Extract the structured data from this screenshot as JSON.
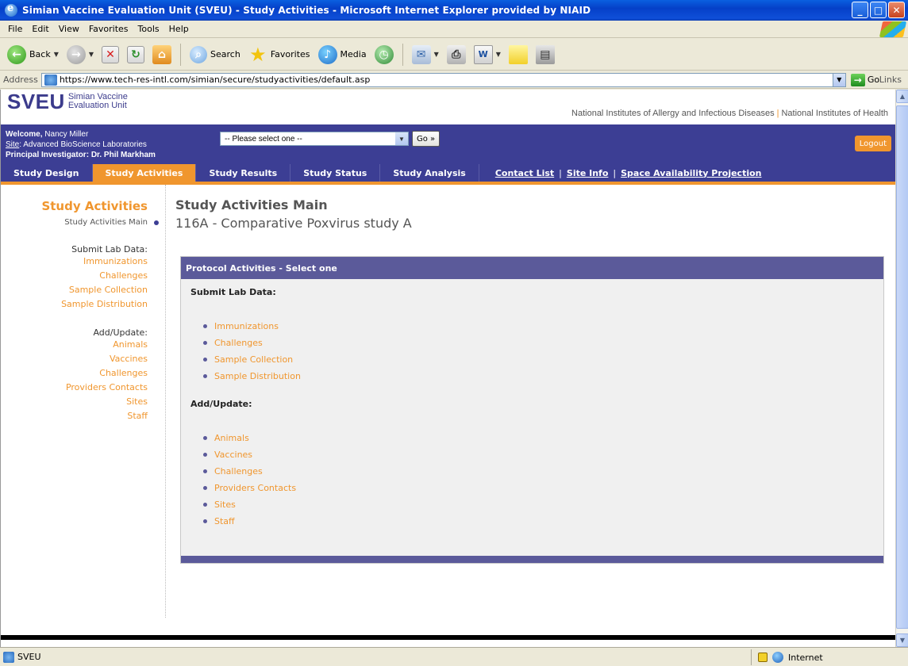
{
  "window": {
    "title": "Simian Vaccine Evaluation Unit (SVEU) - Study Activities - Microsoft Internet Explorer provided by NIAID"
  },
  "menu": [
    "File",
    "Edit",
    "View",
    "Favorites",
    "Tools",
    "Help"
  ],
  "toolbar": {
    "back": "Back",
    "search": "Search",
    "favorites": "Favorites",
    "media": "Media"
  },
  "address": {
    "label": "Address",
    "url": "https://www.tech-res-intl.com/simian/secure/studyactivities/default.asp",
    "go": "Go",
    "links": "Links"
  },
  "header": {
    "logo_big": "SVEU",
    "logo_small_1": "Simian Vaccine",
    "logo_small_2": "Evaluation Unit",
    "niaid": "National Institutes of Allergy and Infectious Diseases",
    "nih": "National Institutes of Health"
  },
  "userbar": {
    "welcome_label": "Welcome,",
    "welcome_name": "Nancy Miller",
    "site_label": "Site",
    "site_value": ": Advanced BioScience Laboratories",
    "pi_label": "Principal Investigator:",
    "pi_value": "Dr. Phil Markham",
    "select_value": "-- Please select one --",
    "go": "Go »",
    "logout": "Logout"
  },
  "nav": {
    "tabs": [
      "Study Design",
      "Study Activities",
      "Study Results",
      "Study Status",
      "Study Analysis"
    ],
    "active": "Study Activities",
    "links": [
      "Contact List",
      "Site Info",
      "Space Availability Projection"
    ]
  },
  "sidebar": {
    "title": "Study Activities",
    "current": "Study Activities Main",
    "group1": "Submit Lab Data:",
    "group1_items": [
      "Immunizations",
      "Challenges",
      "Sample Collection",
      "Sample Distribution"
    ],
    "group2": "Add/Update:",
    "group2_items": [
      "Animals",
      "Vaccines",
      "Challenges",
      "Providers Contacts",
      "Sites",
      "Staff"
    ]
  },
  "main": {
    "title": "Study Activities Main",
    "subtitle": "116A - Comparative Poxvirus study A",
    "panel_header": "Protocol Activities - Select one",
    "section1": "Submit Lab Data:",
    "section1_items": [
      "Immunizations",
      "Challenges",
      "Sample Collection",
      "Sample Distribution"
    ],
    "section2": "Add/Update:",
    "section2_items": [
      "Animals",
      "Vaccines",
      "Challenges",
      "Providers Contacts",
      "Sites",
      "Staff"
    ]
  },
  "status": {
    "text": "SVEU",
    "zone": "Internet"
  }
}
